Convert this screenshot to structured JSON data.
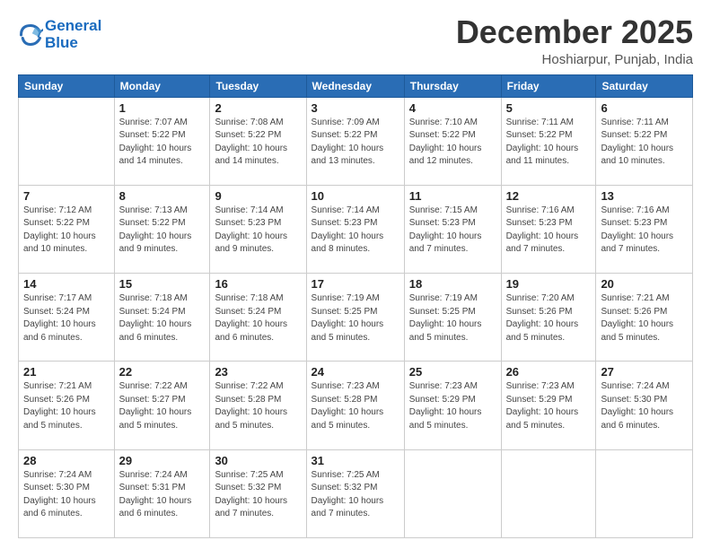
{
  "logo": {
    "line1": "General",
    "line2": "Blue"
  },
  "title": "December 2025",
  "location": "Hoshiarpur, Punjab, India",
  "days_header": [
    "Sunday",
    "Monday",
    "Tuesday",
    "Wednesday",
    "Thursday",
    "Friday",
    "Saturday"
  ],
  "weeks": [
    [
      {
        "num": "",
        "info": ""
      },
      {
        "num": "1",
        "info": "Sunrise: 7:07 AM\nSunset: 5:22 PM\nDaylight: 10 hours\nand 14 minutes."
      },
      {
        "num": "2",
        "info": "Sunrise: 7:08 AM\nSunset: 5:22 PM\nDaylight: 10 hours\nand 14 minutes."
      },
      {
        "num": "3",
        "info": "Sunrise: 7:09 AM\nSunset: 5:22 PM\nDaylight: 10 hours\nand 13 minutes."
      },
      {
        "num": "4",
        "info": "Sunrise: 7:10 AM\nSunset: 5:22 PM\nDaylight: 10 hours\nand 12 minutes."
      },
      {
        "num": "5",
        "info": "Sunrise: 7:11 AM\nSunset: 5:22 PM\nDaylight: 10 hours\nand 11 minutes."
      },
      {
        "num": "6",
        "info": "Sunrise: 7:11 AM\nSunset: 5:22 PM\nDaylight: 10 hours\nand 10 minutes."
      }
    ],
    [
      {
        "num": "7",
        "info": "Sunrise: 7:12 AM\nSunset: 5:22 PM\nDaylight: 10 hours\nand 10 minutes."
      },
      {
        "num": "8",
        "info": "Sunrise: 7:13 AM\nSunset: 5:22 PM\nDaylight: 10 hours\nand 9 minutes."
      },
      {
        "num": "9",
        "info": "Sunrise: 7:14 AM\nSunset: 5:23 PM\nDaylight: 10 hours\nand 9 minutes."
      },
      {
        "num": "10",
        "info": "Sunrise: 7:14 AM\nSunset: 5:23 PM\nDaylight: 10 hours\nand 8 minutes."
      },
      {
        "num": "11",
        "info": "Sunrise: 7:15 AM\nSunset: 5:23 PM\nDaylight: 10 hours\nand 7 minutes."
      },
      {
        "num": "12",
        "info": "Sunrise: 7:16 AM\nSunset: 5:23 PM\nDaylight: 10 hours\nand 7 minutes."
      },
      {
        "num": "13",
        "info": "Sunrise: 7:16 AM\nSunset: 5:23 PM\nDaylight: 10 hours\nand 7 minutes."
      }
    ],
    [
      {
        "num": "14",
        "info": "Sunrise: 7:17 AM\nSunset: 5:24 PM\nDaylight: 10 hours\nand 6 minutes."
      },
      {
        "num": "15",
        "info": "Sunrise: 7:18 AM\nSunset: 5:24 PM\nDaylight: 10 hours\nand 6 minutes."
      },
      {
        "num": "16",
        "info": "Sunrise: 7:18 AM\nSunset: 5:24 PM\nDaylight: 10 hours\nand 6 minutes."
      },
      {
        "num": "17",
        "info": "Sunrise: 7:19 AM\nSunset: 5:25 PM\nDaylight: 10 hours\nand 5 minutes."
      },
      {
        "num": "18",
        "info": "Sunrise: 7:19 AM\nSunset: 5:25 PM\nDaylight: 10 hours\nand 5 minutes."
      },
      {
        "num": "19",
        "info": "Sunrise: 7:20 AM\nSunset: 5:26 PM\nDaylight: 10 hours\nand 5 minutes."
      },
      {
        "num": "20",
        "info": "Sunrise: 7:21 AM\nSunset: 5:26 PM\nDaylight: 10 hours\nand 5 minutes."
      }
    ],
    [
      {
        "num": "21",
        "info": "Sunrise: 7:21 AM\nSunset: 5:26 PM\nDaylight: 10 hours\nand 5 minutes."
      },
      {
        "num": "22",
        "info": "Sunrise: 7:22 AM\nSunset: 5:27 PM\nDaylight: 10 hours\nand 5 minutes."
      },
      {
        "num": "23",
        "info": "Sunrise: 7:22 AM\nSunset: 5:28 PM\nDaylight: 10 hours\nand 5 minutes."
      },
      {
        "num": "24",
        "info": "Sunrise: 7:23 AM\nSunset: 5:28 PM\nDaylight: 10 hours\nand 5 minutes."
      },
      {
        "num": "25",
        "info": "Sunrise: 7:23 AM\nSunset: 5:29 PM\nDaylight: 10 hours\nand 5 minutes."
      },
      {
        "num": "26",
        "info": "Sunrise: 7:23 AM\nSunset: 5:29 PM\nDaylight: 10 hours\nand 5 minutes."
      },
      {
        "num": "27",
        "info": "Sunrise: 7:24 AM\nSunset: 5:30 PM\nDaylight: 10 hours\nand 6 minutes."
      }
    ],
    [
      {
        "num": "28",
        "info": "Sunrise: 7:24 AM\nSunset: 5:30 PM\nDaylight: 10 hours\nand 6 minutes."
      },
      {
        "num": "29",
        "info": "Sunrise: 7:24 AM\nSunset: 5:31 PM\nDaylight: 10 hours\nand 6 minutes."
      },
      {
        "num": "30",
        "info": "Sunrise: 7:25 AM\nSunset: 5:32 PM\nDaylight: 10 hours\nand 7 minutes."
      },
      {
        "num": "31",
        "info": "Sunrise: 7:25 AM\nSunset: 5:32 PM\nDaylight: 10 hours\nand 7 minutes."
      },
      {
        "num": "",
        "info": ""
      },
      {
        "num": "",
        "info": ""
      },
      {
        "num": "",
        "info": ""
      }
    ]
  ]
}
